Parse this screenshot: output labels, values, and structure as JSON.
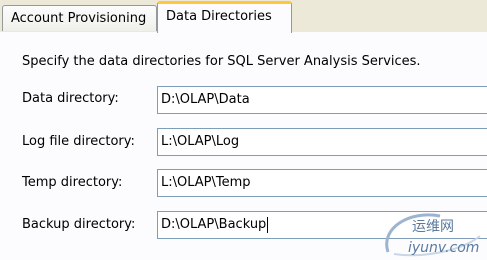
{
  "tabs": [
    {
      "label": "Account Provisioning",
      "active": false
    },
    {
      "label": "Data Directories",
      "active": true
    }
  ],
  "description": "Specify the data directories for SQL Server Analysis Services.",
  "fields": [
    {
      "label": "Data directory:",
      "value": "D:\\OLAP\\Data"
    },
    {
      "label": "Log file directory:",
      "value": "L:\\OLAP\\Log"
    },
    {
      "label": "Temp directory:",
      "value": "L:\\OLAP\\Temp"
    },
    {
      "label": "Backup directory:",
      "value": "D:\\OLAP\\Backup"
    }
  ],
  "watermark": {
    "line1": "运维网",
    "line2": "iyunv.com"
  },
  "colors": {
    "tab_highlight": "#ffc83c",
    "field_border": "#7f9db9",
    "watermark": "#5a7aa0"
  }
}
